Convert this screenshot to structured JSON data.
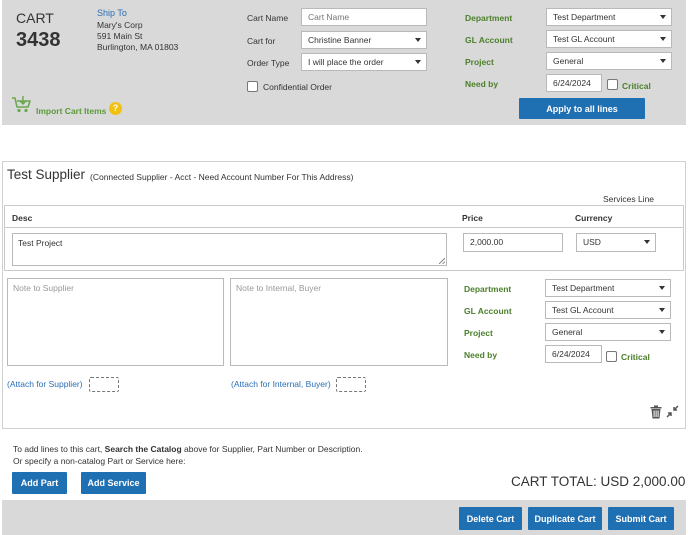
{
  "cart": {
    "label": "CART",
    "number": "3438"
  },
  "ship_to": {
    "link": "Ship To",
    "name": "Mary's Corp",
    "street": "591 Main St",
    "city": "Burlington, MA 01803"
  },
  "order": {
    "cart_name_label": "Cart Name",
    "cart_name_placeholder": "Cart Name",
    "cart_for_label": "Cart for",
    "cart_for_value": "Christine Banner",
    "order_type_label": "Order Type",
    "order_type_value": "I will place the order",
    "confidential_label": "Confidential Order"
  },
  "header_accounting": {
    "department_label": "Department",
    "department_value": "Test Department",
    "gl_label": "GL Account",
    "gl_value": "Test GL Account",
    "project_label": "Project",
    "project_value": "General",
    "needby_label": "Need by",
    "needby_value": "6/24/2024",
    "critical_label": "Critical",
    "apply_button": "Apply to all lines"
  },
  "import": {
    "label": "Import Cart Items",
    "help": "?"
  },
  "supplier": {
    "name": "Test Supplier",
    "note": "(Connected Supplier - Acct - Need Account Number For This Address)",
    "services_line": "Services Line"
  },
  "line": {
    "desc_header": "Desc",
    "price_header": "Price",
    "currency_header": "Currency",
    "desc_value": "Test Project",
    "price_value": "2,000.00",
    "currency_value": "USD"
  },
  "notes": {
    "supplier_placeholder": "Note to Supplier",
    "internal_placeholder": "Note to Internal, Buyer",
    "attach_supplier": "(Attach for Supplier)",
    "attach_internal": "(Attach for Internal, Buyer)"
  },
  "line_accounting": {
    "department_label": "Department",
    "department_value": "Test Department",
    "gl_label": "GL Account",
    "gl_value": "Test GL Account",
    "project_label": "Project",
    "project_value": "General",
    "needby_label": "Need by",
    "needby_value": "6/24/2024",
    "critical_label": "Critical"
  },
  "add_lines": {
    "text_prefix": "To add lines to this cart, ",
    "text_bold": "Search the Catalog",
    "text_suffix": " above for Supplier, Part Number or Description.",
    "text_line2": "Or specify a non-catalog Part or Service here:",
    "add_part": "Add Part",
    "add_service": "Add Service"
  },
  "total": "CART TOTAL: USD 2,000.00",
  "footer": {
    "delete": "Delete Cart",
    "duplicate": "Duplicate Cart",
    "submit": "Submit Cart"
  }
}
